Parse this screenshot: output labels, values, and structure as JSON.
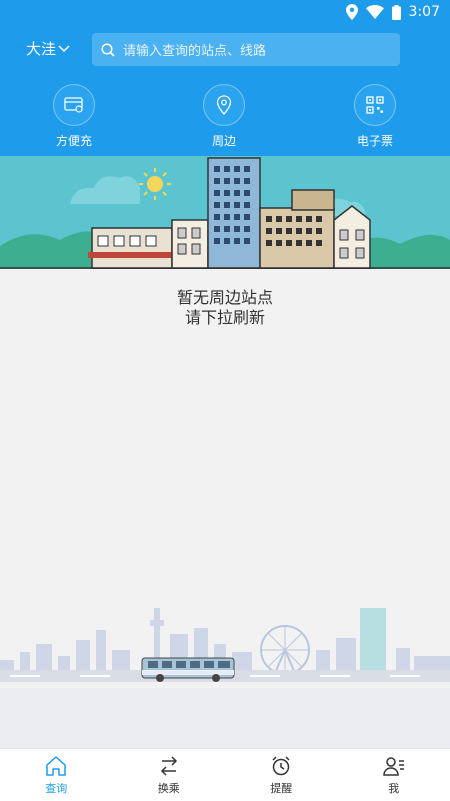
{
  "status_bar": {
    "time": "3:07"
  },
  "header": {
    "city": "大洼",
    "search_placeholder": "请输入查询的站点、线路",
    "quick_actions": [
      {
        "label": "方便充",
        "icon": "card-icon"
      },
      {
        "label": "周边",
        "icon": "location-icon"
      },
      {
        "label": "电子票",
        "icon": "qrcode-icon"
      }
    ]
  },
  "empty_state": {
    "line1": "暂无周边站点",
    "line2": "请下拉刷新"
  },
  "tabs": [
    {
      "label": "查询",
      "icon": "home-icon",
      "active": true
    },
    {
      "label": "换乘",
      "icon": "transfer-icon",
      "active": false
    },
    {
      "label": "提醒",
      "icon": "alarm-icon",
      "active": false
    },
    {
      "label": "我",
      "icon": "profile-icon",
      "active": false
    }
  ],
  "colors": {
    "primary": "#1E9BEB",
    "background": "#F2F2F2"
  }
}
